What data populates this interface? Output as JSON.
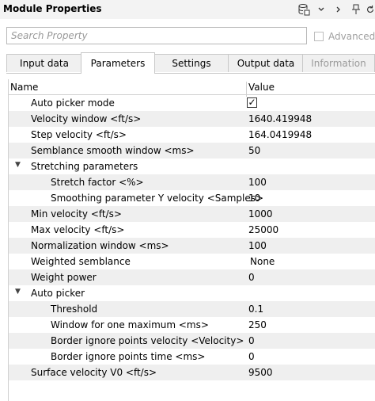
{
  "window": {
    "title": "Module Properties"
  },
  "search": {
    "placeholder": "Search Property",
    "advanced_label": "Advanced"
  },
  "tabs": [
    {
      "label": "Input data",
      "active": false,
      "enabled": true
    },
    {
      "label": "Parameters",
      "active": true,
      "enabled": true
    },
    {
      "label": "Settings",
      "active": false,
      "enabled": true
    },
    {
      "label": "Output data",
      "active": false,
      "enabled": true
    },
    {
      "label": "Information",
      "active": false,
      "enabled": false
    }
  ],
  "grid": {
    "headers": {
      "name": "Name",
      "value": "Value"
    },
    "rows": [
      {
        "name": "Auto picker mode",
        "value": "",
        "checked": true
      },
      {
        "name": "Velocity window <ft/s>",
        "value": "1640.419948"
      },
      {
        "name": "Step velocity <ft/s>",
        "value": "164.0419948"
      },
      {
        "name": "Semblance smooth window <ms>",
        "value": "50"
      },
      {
        "name": "Stretching parameters",
        "value": "",
        "expanded": true
      },
      {
        "name": "Stretch factor <%>",
        "value": "100"
      },
      {
        "name": "Smoothing parameter Y velocity <Samples>",
        "value": "10"
      },
      {
        "name": "Min velocity <ft/s>",
        "value": "1000"
      },
      {
        "name": "Max velocity <ft/s>",
        "value": "25000"
      },
      {
        "name": "Normalization window <ms>",
        "value": "100"
      },
      {
        "name": "Weighted semblance",
        "value": "None"
      },
      {
        "name": "Weight power",
        "value": "0"
      },
      {
        "name": "Auto picker",
        "value": "",
        "expanded": true
      },
      {
        "name": "Threshold",
        "value": "0.1"
      },
      {
        "name": "Window for one maximum <ms>",
        "value": "250"
      },
      {
        "name": "Border ignore points velocity <Velocity>",
        "value": "0"
      },
      {
        "name": "Border ignore points time <ms>",
        "value": "0"
      },
      {
        "name": "Surface velocity V0 <ft/s>",
        "value": "9500"
      }
    ]
  },
  "icons": {
    "toolbar": [
      "database-icon",
      "chevron-down-icon",
      "chevron-right-icon",
      "pin-icon",
      "refresh-icon"
    ]
  }
}
